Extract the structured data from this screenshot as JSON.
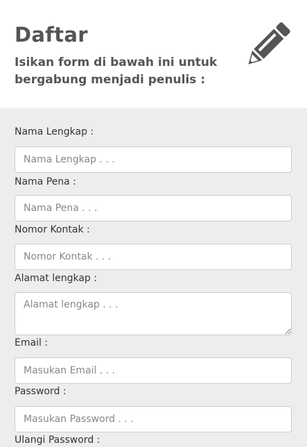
{
  "header": {
    "title": "Daftar",
    "subtitle": "Isikan form di bawah ini untuk bergabung menjadi penulis :",
    "icon": "pencil-icon"
  },
  "form": {
    "fields": [
      {
        "label": "Nama Lengkap :",
        "placeholder": "Nama Lengkap . . ."
      },
      {
        "label": "Nama Pena :",
        "placeholder": "Nama Pena . . ."
      },
      {
        "label": "Nomor Kontak :",
        "placeholder": "Nomor Kontak . . ."
      },
      {
        "label": "Alamat lengkap :",
        "placeholder": "Alamat lengkap . . ."
      },
      {
        "label": "Email :",
        "placeholder": "Masukan Email . . ."
      },
      {
        "label": "Password :",
        "placeholder": "Masukan Password . . ."
      },
      {
        "label": "Ulangi Password :"
      }
    ]
  },
  "colors": {
    "header_bg": "#ffffff",
    "form_bg": "#ededed",
    "heading_text": "#555555",
    "input_border": "#cccccc"
  }
}
